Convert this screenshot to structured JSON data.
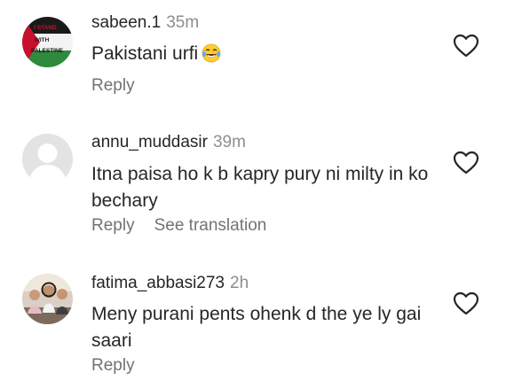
{
  "comments": [
    {
      "username": "sabeen.1",
      "time": "35m",
      "text": "Pakistani urfi",
      "emoji": "laughing-with-tears-emoji",
      "avatar_text_1": "I STAND",
      "avatar_text_2": "WITH",
      "avatar_text_3": "PALESTINE",
      "actions": [
        "Reply"
      ]
    },
    {
      "username": "annu_muddasir",
      "time": "39m",
      "text": "Itna paisa ho k b kapry pury ni milty in ko bechary",
      "actions": [
        "Reply",
        "See translation"
      ]
    },
    {
      "username": "fatima_abbasi273",
      "time": "2h",
      "text": "Meny purani pents ohenk d the ye ly gai saari",
      "actions": [
        "Reply"
      ]
    }
  ],
  "icons": {
    "like": "heart-outline-icon"
  },
  "colors": {
    "text": "#262626",
    "secondary": "#8e8e8e",
    "action": "#737373"
  }
}
